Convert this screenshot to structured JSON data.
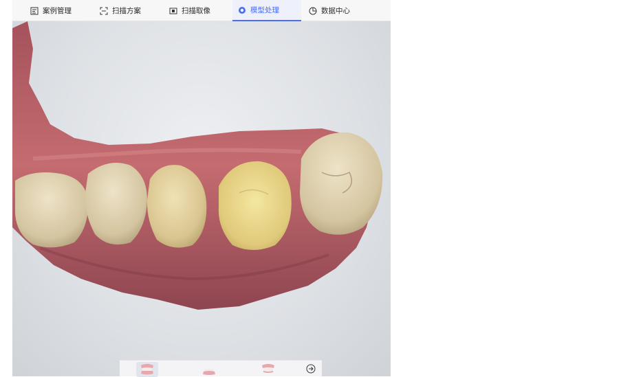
{
  "tabs": [
    {
      "label": "案例管理",
      "icon": "case-list-icon",
      "active": false
    },
    {
      "label": "扫描方案",
      "icon": "scan-frame-icon",
      "active": false
    },
    {
      "label": "扫描取像",
      "icon": "capture-icon",
      "active": false
    },
    {
      "label": "模型处理",
      "icon": "model-process-icon",
      "active": true
    },
    {
      "label": "数据中心",
      "icon": "clock-chart-icon",
      "active": false
    }
  ],
  "bottom_toolbar": {
    "buttons": [
      {
        "icon": "upper-lower-jaw-icon",
        "active": true
      },
      {
        "icon": "lower-jaw-icon",
        "active": false
      },
      {
        "icon": "upper-jaw-icon",
        "active": false
      }
    ],
    "next_icon": "arrow-right-circle-icon"
  },
  "colors": {
    "accent": "#4a6cf7",
    "gum": "#b85f66",
    "tooth": "#e2d3a6"
  }
}
